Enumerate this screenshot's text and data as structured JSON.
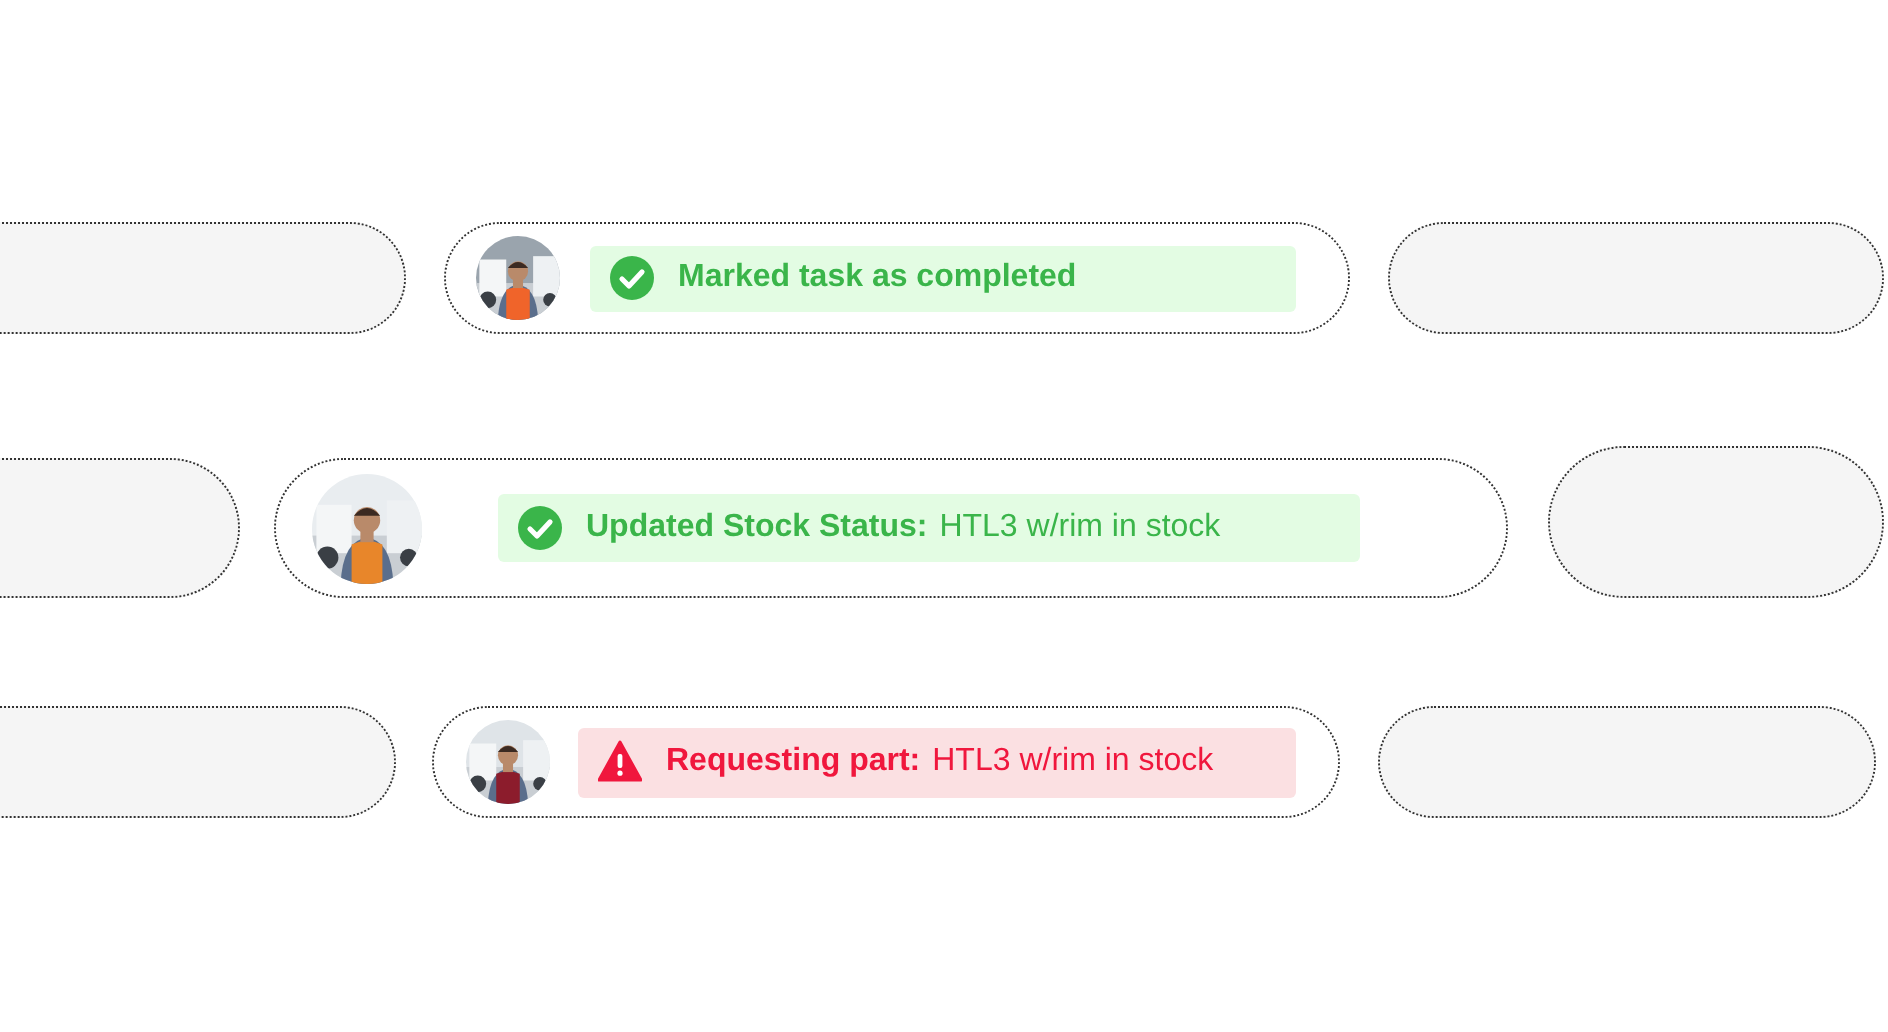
{
  "activities": [
    {
      "kind": "success",
      "label": "Marked task as completed"
    },
    {
      "kind": "success",
      "label": "Updated Stock Status:",
      "detail": "HTL3 w/rim in stock"
    },
    {
      "kind": "warning",
      "label": "Requesting part:",
      "detail": "HTL3 w/rim in stock"
    }
  ]
}
